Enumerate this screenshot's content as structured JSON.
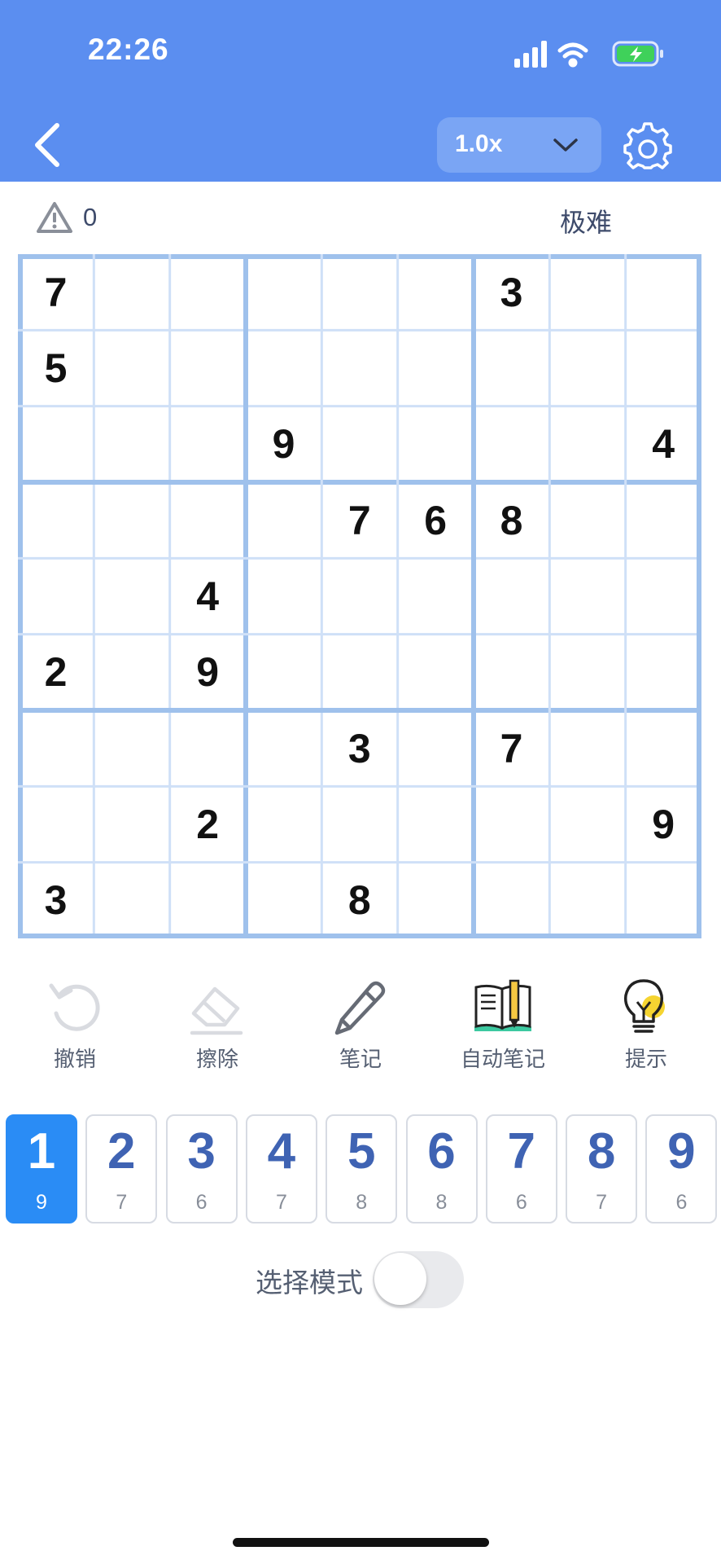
{
  "status_bar": {
    "time": "22:26",
    "icons": [
      "signal-icon",
      "wifi-icon",
      "battery-charging-icon"
    ]
  },
  "header": {
    "speed": "1.0x",
    "back_icon": "chevron-left-icon",
    "settings_icon": "gear-icon"
  },
  "info": {
    "mistakes": "0",
    "difficulty": "极难"
  },
  "board": {
    "cells": [
      {
        "row": 0,
        "col": 0,
        "value": "7"
      },
      {
        "row": 0,
        "col": 6,
        "value": "3"
      },
      {
        "row": 1,
        "col": 0,
        "value": "5"
      },
      {
        "row": 2,
        "col": 3,
        "value": "9"
      },
      {
        "row": 2,
        "col": 8,
        "value": "4"
      },
      {
        "row": 3,
        "col": 4,
        "value": "7"
      },
      {
        "row": 3,
        "col": 5,
        "value": "6"
      },
      {
        "row": 3,
        "col": 6,
        "value": "8"
      },
      {
        "row": 4,
        "col": 2,
        "value": "4"
      },
      {
        "row": 5,
        "col": 0,
        "value": "2"
      },
      {
        "row": 5,
        "col": 2,
        "value": "9"
      },
      {
        "row": 6,
        "col": 4,
        "value": "3"
      },
      {
        "row": 6,
        "col": 6,
        "value": "7"
      },
      {
        "row": 7,
        "col": 2,
        "value": "2"
      },
      {
        "row": 7,
        "col": 8,
        "value": "9"
      },
      {
        "row": 8,
        "col": 0,
        "value": "3"
      },
      {
        "row": 8,
        "col": 4,
        "value": "8"
      }
    ]
  },
  "tools": [
    {
      "label": "撤销",
      "icon": "undo-icon"
    },
    {
      "label": "擦除",
      "icon": "eraser-icon"
    },
    {
      "label": "笔记",
      "icon": "pencil-icon"
    },
    {
      "label": "自动笔记",
      "icon": "book-pencil-icon"
    },
    {
      "label": "提示",
      "icon": "lightbulb-icon"
    }
  ],
  "numpad": {
    "selected": "1",
    "keys": [
      {
        "digit": "1",
        "count": "9"
      },
      {
        "digit": "2",
        "count": "7"
      },
      {
        "digit": "3",
        "count": "6"
      },
      {
        "digit": "4",
        "count": "7"
      },
      {
        "digit": "5",
        "count": "8"
      },
      {
        "digit": "6",
        "count": "8"
      },
      {
        "digit": "7",
        "count": "6"
      },
      {
        "digit": "8",
        "count": "7"
      },
      {
        "digit": "9",
        "count": "6"
      }
    ]
  },
  "select_mode": {
    "label": "选择模式",
    "enabled": false
  },
  "colors": {
    "header_bg": "#5b8ef0",
    "grid_line": "#cfe0f7",
    "box_line": "#9fc1ec",
    "selected_key": "#2a8cf5",
    "digit_blue": "#3f63b3"
  }
}
